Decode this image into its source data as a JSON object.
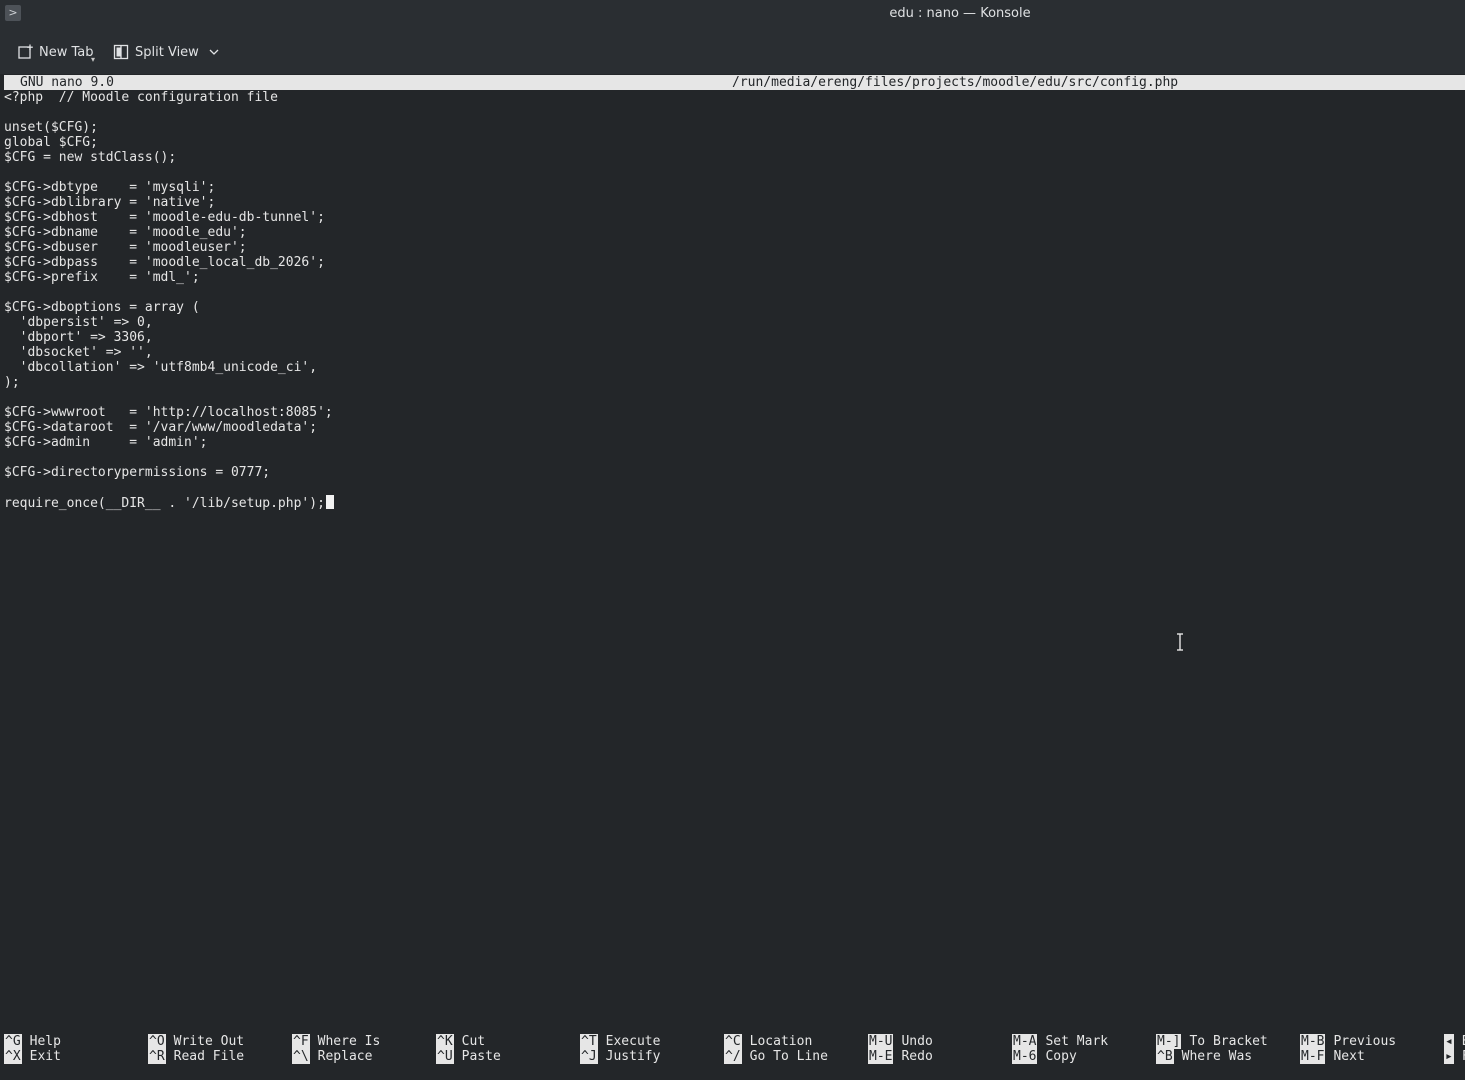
{
  "window": {
    "title": "edu : nano — Konsole",
    "app_menu_glyph": ">"
  },
  "toolbar": {
    "new_tab_label": "New Tab",
    "split_view_label": "Split View"
  },
  "nano": {
    "version_label": "GNU nano 9.0",
    "file_path": "/run/media/ereng/files/projects/moodle/edu/src/config.php"
  },
  "editor": {
    "lines": [
      "<?php  // Moodle configuration file",
      "",
      "unset($CFG);",
      "global $CFG;",
      "$CFG = new stdClass();",
      "",
      "$CFG->dbtype    = 'mysqli';",
      "$CFG->dblibrary = 'native';",
      "$CFG->dbhost    = 'moodle-edu-db-tunnel';",
      "$CFG->dbname    = 'moodle_edu';",
      "$CFG->dbuser    = 'moodleuser';",
      "$CFG->dbpass    = 'moodle_local_db_2026';",
      "$CFG->prefix    = 'mdl_';",
      "",
      "$CFG->dboptions = array (",
      "  'dbpersist' => 0,",
      "  'dbport' => 3306,",
      "  'dbsocket' => '',",
      "  'dbcollation' => 'utf8mb4_unicode_ci',",
      ");",
      "",
      "$CFG->wwwroot   = 'http://localhost:8085';",
      "$CFG->dataroot  = '/var/www/moodledata';",
      "$CFG->admin     = 'admin';",
      "",
      "$CFG->directorypermissions = 0777;",
      "",
      "require_once(__DIR__ . '/lib/setup.php');"
    ]
  },
  "shortcuts": {
    "top": [
      {
        "key": "^G",
        "label": "Help"
      },
      {
        "key": "^O",
        "label": "Write Out"
      },
      {
        "key": "^F",
        "label": "Where Is"
      },
      {
        "key": "^K",
        "label": "Cut"
      },
      {
        "key": "^T",
        "label": "Execute"
      },
      {
        "key": "^C",
        "label": "Location"
      },
      {
        "key": "M-U",
        "label": "Undo"
      },
      {
        "key": "M-A",
        "label": "Set Mark"
      },
      {
        "key": "M-]",
        "label": "To Bracket"
      },
      {
        "key": "M-B",
        "label": "Previous"
      },
      {
        "key": "◂",
        "label": "B"
      }
    ],
    "bottom": [
      {
        "key": "^X",
        "label": "Exit"
      },
      {
        "key": "^R",
        "label": "Read File"
      },
      {
        "key": "^\\",
        "label": "Replace"
      },
      {
        "key": "^U",
        "label": "Paste"
      },
      {
        "key": "^J",
        "label": "Justify"
      },
      {
        "key": "^/",
        "label": "Go To Line"
      },
      {
        "key": "M-E",
        "label": "Redo"
      },
      {
        "key": "M-6",
        "label": "Copy"
      },
      {
        "key": "^B",
        "label": "Where Was"
      },
      {
        "key": "M-F",
        "label": "Next"
      },
      {
        "key": "▸",
        "label": "F"
      }
    ]
  }
}
